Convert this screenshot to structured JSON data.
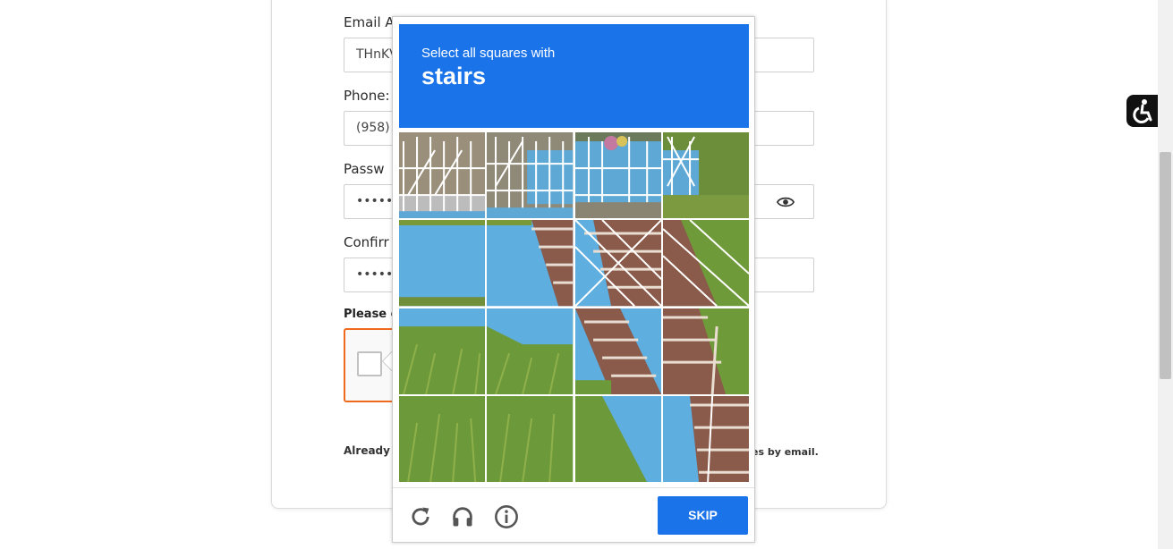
{
  "form": {
    "fields": [
      {
        "label": "Email A",
        "value": "THnKV"
      },
      {
        "label": "Phone:",
        "value": "(958)"
      },
      {
        "label": "Passw",
        "value": "•••••••"
      },
      {
        "label": "Confirr",
        "value": "•••••••"
      }
    ],
    "consent_label": "Please c",
    "already_text": "Already",
    "updates_text": "es by email."
  },
  "captcha": {
    "prompt_line": "Select all squares with",
    "target": "stairs",
    "skip_label": "SKIP",
    "tiles_count": 16,
    "accent": "#1a73e8"
  },
  "colors": {
    "recaptcha_border": "#f06a1d",
    "accessibility_bg": "#111111"
  }
}
